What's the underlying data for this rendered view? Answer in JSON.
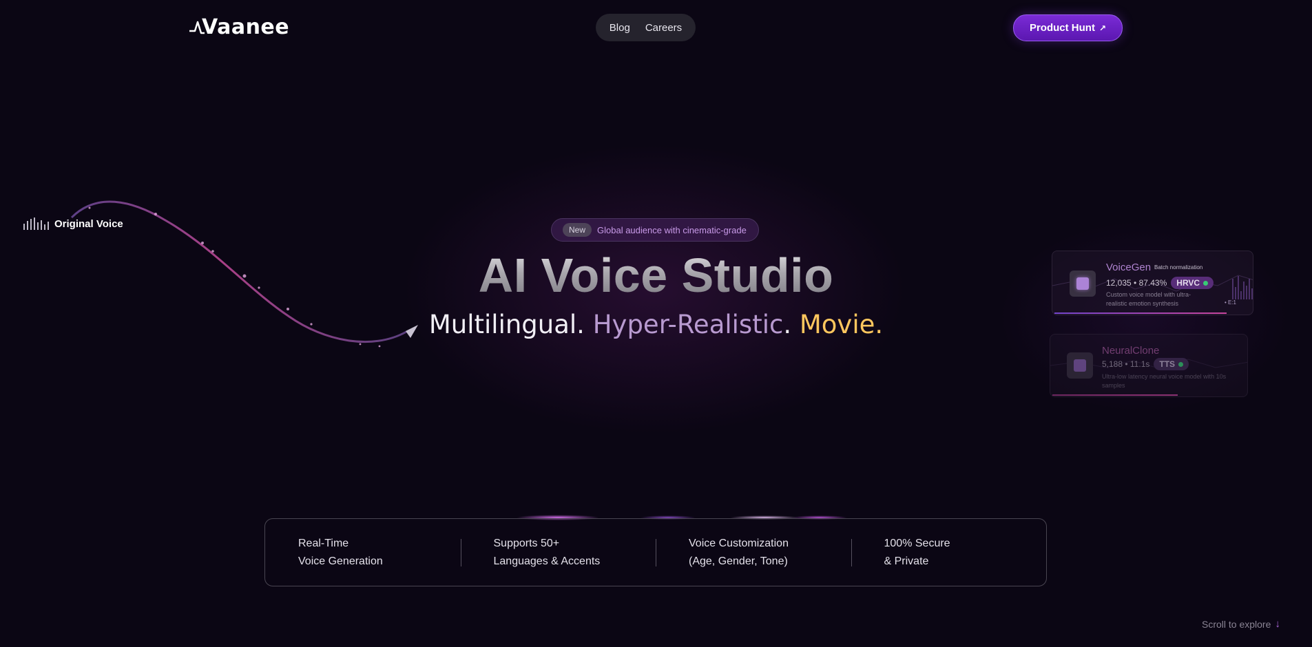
{
  "header": {
    "logo_text": "Vaanee",
    "nav": [
      {
        "label": "Blog"
      },
      {
        "label": "Careers"
      }
    ],
    "cta_label": "Product Hunt"
  },
  "original_voice": {
    "label": "Original Voice"
  },
  "hero": {
    "badge_new": "New",
    "badge_text": "Global audience with cinematic-grade",
    "title": "AI Voice Studio",
    "subtitle_1": "Multilingual.",
    "subtitle_2": "Hyper-Realistic",
    "subtitle_dot": ".",
    "subtitle_3": "Movie."
  },
  "cards": [
    {
      "title": "VoiceGen",
      "tag": "Batch normalization",
      "stats": "12,035 • 87.43%",
      "pill": "HRVC",
      "description": "Custom voice model with ultra-realistic emotion synthesis",
      "corner": "• E:1",
      "progress": 0.85
    },
    {
      "title": "NeuralClone",
      "tag": "",
      "stats": "5,188 • 11.1s",
      "pill": "TTS",
      "description": "Ultra-low latency neural voice model with 10s samples",
      "corner": "",
      "progress": 0.6
    }
  ],
  "features": [
    {
      "line1": "Real-Time",
      "line2": "Voice Generation"
    },
    {
      "line1": "Supports 50+",
      "line2": "Languages & Accents"
    },
    {
      "line1": "Voice Customization",
      "line2": "(Age, Gender, Tone)"
    },
    {
      "line1": "100% Secure",
      "line2": "& Private"
    }
  ],
  "scroll_label": "Scroll to explore",
  "colors": {
    "background": "#0b0614",
    "accent": "#7a2bd6",
    "movie": "#ffc75e",
    "hyper": "#b89ad0"
  }
}
